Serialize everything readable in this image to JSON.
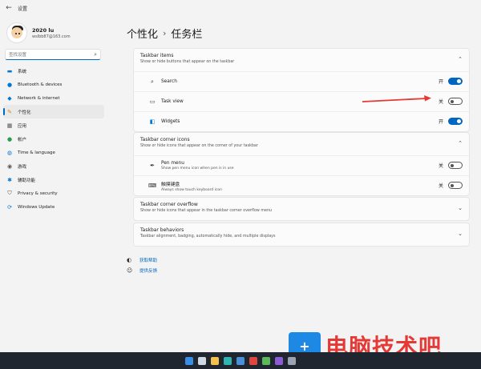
{
  "app": {
    "title": "设置",
    "back_icon": "back-arrow-icon"
  },
  "profile": {
    "name": "2020 lu",
    "email": "wslbb87@163.com"
  },
  "search": {
    "placeholder": "查找设置"
  },
  "sidebar": {
    "items": [
      {
        "label": "系统",
        "icon": "monitor-icon",
        "color": "#0078d4"
      },
      {
        "label": "Bluetooth & devices",
        "icon": "bluetooth-icon",
        "color": "#0078d4"
      },
      {
        "label": "Network & internet",
        "icon": "wifi-icon",
        "color": "#0078d4"
      },
      {
        "label": "个性化",
        "icon": "brush-icon",
        "color": "#d08b1a",
        "active": true
      },
      {
        "label": "应用",
        "icon": "apps-icon",
        "color": "#555555"
      },
      {
        "label": "帐户",
        "icon": "account-icon",
        "color": "#2a9d4a"
      },
      {
        "label": "Time & language",
        "icon": "globe-icon",
        "color": "#0078d4"
      },
      {
        "label": "游戏",
        "icon": "gamepad-icon",
        "color": "#555555"
      },
      {
        "label": "辅助功能",
        "icon": "accessibility-icon",
        "color": "#0078d4"
      },
      {
        "label": "Privacy & security",
        "icon": "shield-icon",
        "color": "#555555"
      },
      {
        "label": "Windows Update",
        "icon": "update-icon",
        "color": "#0078d4"
      }
    ]
  },
  "breadcrumb": {
    "parent": "个性化",
    "separator": "›",
    "current": "任务栏"
  },
  "taskbar_items": {
    "title": "Taskbar items",
    "subtitle": "Show or hide buttons that appear on the taskbar",
    "rows": [
      {
        "label": "Search",
        "state_text": "开",
        "on": true
      },
      {
        "label": "Task view",
        "state_text": "关",
        "on": false
      },
      {
        "label": "Widgets",
        "state_text": "开",
        "on": true
      }
    ]
  },
  "corner_icons": {
    "title": "Taskbar corner icons",
    "subtitle": "Show or hide icons that appear on the corner of your taskbar",
    "rows": [
      {
        "label": "Pen menu",
        "sub": "Show pen menu icon when pen is in use",
        "state_text": "关",
        "on": false
      },
      {
        "label": "触摸键盘",
        "sub": "Always show touch keyboard icon",
        "state_text": "关",
        "on": false
      }
    ]
  },
  "corner_overflow": {
    "title": "Taskbar corner overflow",
    "subtitle": "Show or hide icons that appear in the taskbar corner overflow menu"
  },
  "behaviors": {
    "title": "Taskbar behaviors",
    "subtitle": "Taskbar alignment, badging, automatically hide, and multiple displays"
  },
  "links": {
    "help": "获取帮助",
    "feedback": "提供反馈"
  },
  "watermark": {
    "text": "电脑技术吧"
  },
  "colors": {
    "accent": "#0067c0",
    "arrow": "#e53935"
  }
}
